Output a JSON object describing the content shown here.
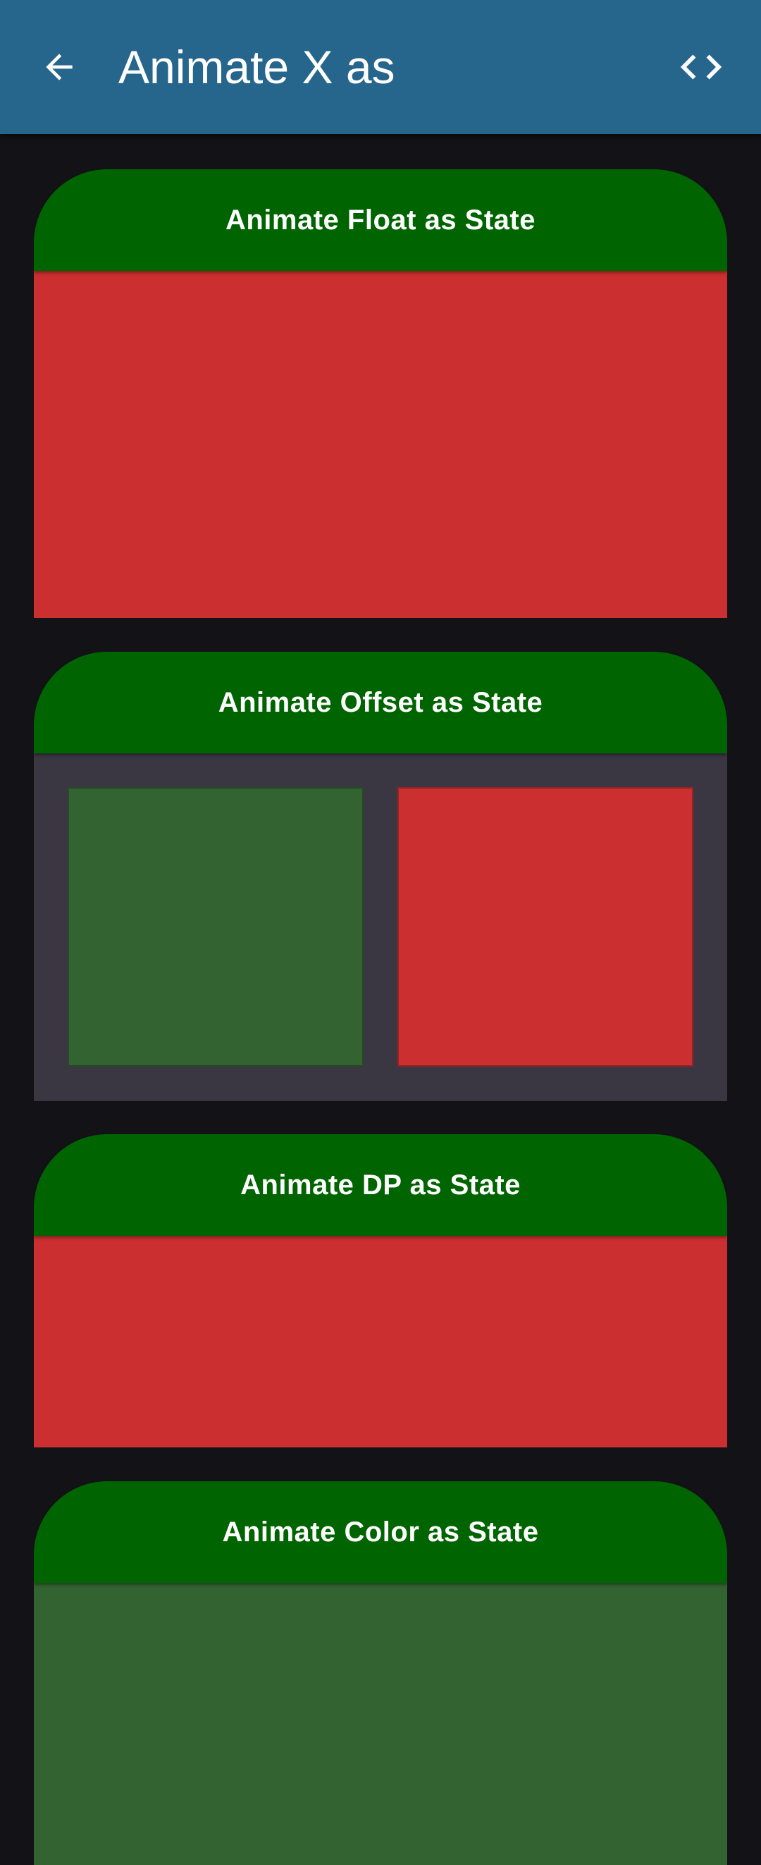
{
  "app_bar": {
    "title": "Animate X as",
    "back_icon": "arrow-left-icon",
    "code_icon": "code-brackets-icon",
    "background_color": "#27668c"
  },
  "cards": [
    {
      "title": "Animate Float as State",
      "body_color": "#cb2f30"
    },
    {
      "title": "Animate Offset as State",
      "body_color": "#3a3742",
      "boxes": [
        {
          "color": "#336331"
        },
        {
          "color": "#cb2f30"
        }
      ]
    },
    {
      "title": "Animate DP as State",
      "body_color": "#cb2f30"
    },
    {
      "title": "Animate Color as State",
      "body_color": "#336331"
    }
  ],
  "colors": {
    "background": "#131217",
    "header_green": "#006400"
  }
}
